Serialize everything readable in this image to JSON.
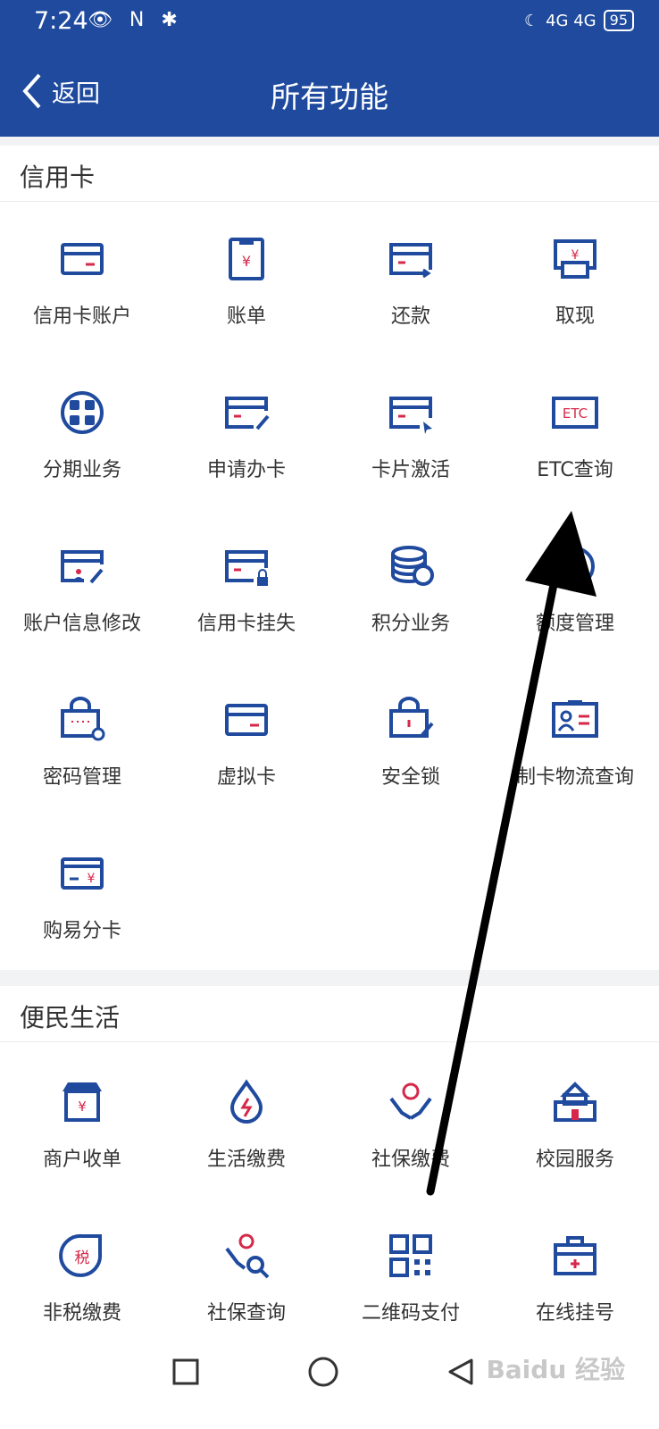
{
  "status": {
    "time": "7:24",
    "left_icons": "👁 N ✱",
    "network": "4G 4G",
    "battery": "95"
  },
  "header": {
    "back_label": "返回",
    "title": "所有功能"
  },
  "sections": [
    {
      "title": "信用卡",
      "items": [
        {
          "label": "信用卡账户",
          "icon": "credit-card-icon"
        },
        {
          "label": "账单",
          "icon": "bill-icon"
        },
        {
          "label": "还款",
          "icon": "repayment-icon"
        },
        {
          "label": "取现",
          "icon": "cash-withdraw-icon"
        },
        {
          "label": "分期业务",
          "icon": "installment-icon"
        },
        {
          "label": "申请办卡",
          "icon": "apply-card-icon"
        },
        {
          "label": "卡片激活",
          "icon": "card-activate-icon"
        },
        {
          "label": "ETC查询",
          "icon": "etc-icon",
          "icon_text": "ETC"
        },
        {
          "label": "账户信息修改",
          "icon": "account-edit-icon"
        },
        {
          "label": "信用卡挂失",
          "icon": "card-lock-icon"
        },
        {
          "label": "积分业务",
          "icon": "coins-icon"
        },
        {
          "label": "额度管理",
          "icon": "quota-icon"
        },
        {
          "label": "密码管理",
          "icon": "password-icon"
        },
        {
          "label": "虚拟卡",
          "icon": "virtual-card-icon"
        },
        {
          "label": "安全锁",
          "icon": "security-lock-icon"
        },
        {
          "label": "制卡物流查询",
          "icon": "id-card-icon"
        },
        {
          "label": "购易分卡",
          "icon": "shopping-card-icon"
        }
      ]
    },
    {
      "title": "便民生活",
      "items": [
        {
          "label": "商户收单",
          "icon": "shop-icon"
        },
        {
          "label": "生活缴费",
          "icon": "utility-icon"
        },
        {
          "label": "社保缴费",
          "icon": "social-security-pay-icon"
        },
        {
          "label": "校园服务",
          "icon": "campus-icon"
        },
        {
          "label": "非税缴费",
          "icon": "tax-icon",
          "icon_text": "税"
        },
        {
          "label": "社保查询",
          "icon": "social-security-query-icon"
        },
        {
          "label": "二维码支付",
          "icon": "qr-code-icon"
        },
        {
          "label": "在线挂号",
          "icon": "medical-kit-icon"
        }
      ]
    }
  ],
  "yuan_symbol": "¥",
  "watermark": "Baidu 经验",
  "colors": {
    "brand_blue": "#1f4a9e",
    "icon_blue": "#1f4a9e",
    "accent_red": "#d6284a"
  }
}
